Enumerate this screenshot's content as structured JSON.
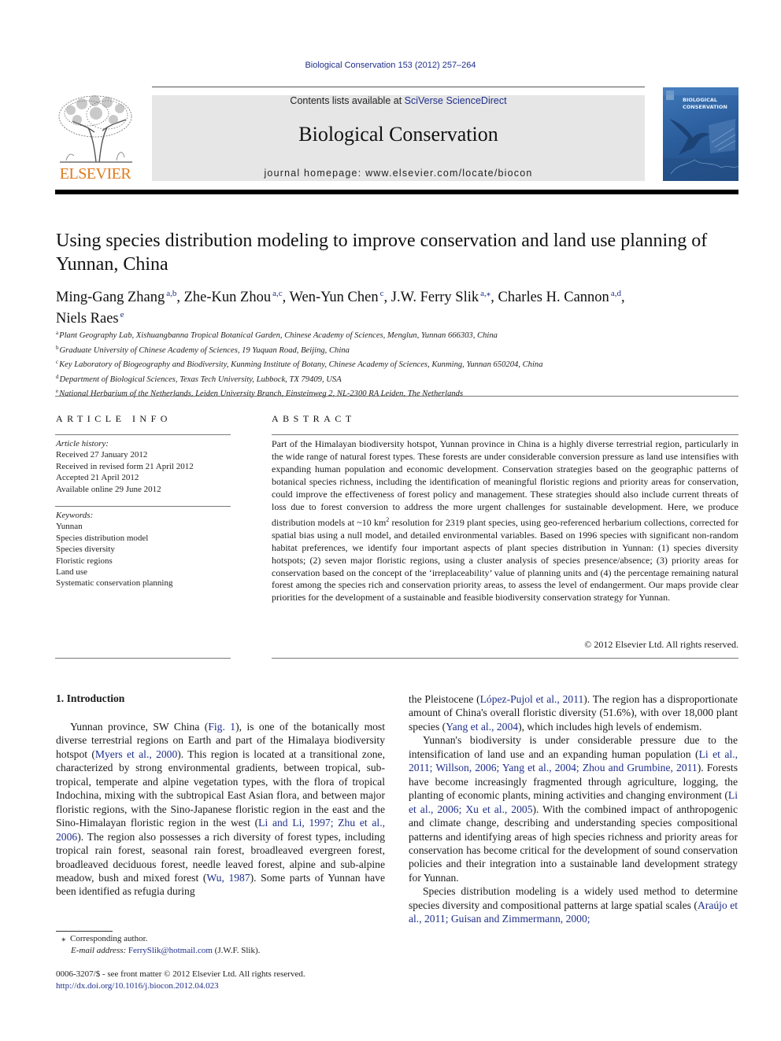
{
  "header": {
    "journal_ref": "Biological Conservation 153 (2012) 257–264",
    "contents_prefix": "Contents lists available at ",
    "contents_link": "SciVerse ScienceDirect",
    "journal_name": "Biological Conservation",
    "homepage_prefix": "journal homepage: ",
    "homepage_url": "www.elsevier.com/locate/biocon",
    "publisher_logo_text": "ELSEVIER",
    "cover_title_line1": "BIOLOGICAL",
    "cover_title_line2": "CONSERVATION",
    "colors": {
      "link": "#1f2f8a",
      "publisher_orange": "#e07a1a",
      "banner_gray": "#e6e6e6",
      "cover_blue": "#2c5f9e"
    }
  },
  "article": {
    "title": "Using species distribution modeling to improve conservation and land use planning of Yunnan, China",
    "authors": [
      {
        "name": "Ming-Gang Zhang",
        "sup": "a,b",
        "sep": ", "
      },
      {
        "name": "Zhe-Kun Zhou",
        "sup": "a,c",
        "sep": ", "
      },
      {
        "name": "Wen-Yun Chen",
        "sup": "c",
        "sep": ", "
      },
      {
        "name": "J.W. Ferry Slik",
        "sup": "a,⁎",
        "sep": ", "
      },
      {
        "name": "Charles H. Cannon",
        "sup": "a,d",
        "sep": ","
      },
      {
        "name": "Niels Raes",
        "sup": "e",
        "sep": ""
      }
    ],
    "affiliations": [
      {
        "key": "a",
        "text": "Plant Geography Lab, Xishuangbanna Tropical Botanical Garden, Chinese Academy of Sciences, Menglun, Yunnan 666303, China"
      },
      {
        "key": "b",
        "text": "Graduate University of Chinese Academy of Sciences, 19 Yuquan Road, Beijing, China"
      },
      {
        "key": "c",
        "text": "Key Laboratory of Biogeography and Biodiversity, Kunming Institute of Botany, Chinese Academy of Sciences, Kunming, Yunnan 650204, China"
      },
      {
        "key": "d",
        "text": "Department of Biological Sciences, Texas Tech University, Lubbock, TX 79409, USA"
      },
      {
        "key": "e",
        "text": "National Herbarium of the Netherlands, Leiden University Branch, Einsteinweg 2, NL-2300 RA Leiden, The Netherlands"
      }
    ]
  },
  "article_info": {
    "heading": "ARTICLE INFO",
    "history_label": "Article history:",
    "history": [
      "Received 27 January 2012",
      "Received in revised form 21 April 2012",
      "Accepted 21 April 2012",
      "Available online 29 June 2012"
    ],
    "keywords_label": "Keywords:",
    "keywords": [
      "Yunnan",
      "Species distribution model",
      "Species diversity",
      "Floristic regions",
      "Land use",
      "Systematic conservation planning"
    ]
  },
  "abstract": {
    "heading": "ABSTRACT",
    "text_before_sup": "Part of the Himalayan biodiversity hotspot, Yunnan province in China is a highly diverse terrestrial region, particularly in the wide range of natural forest types. These forests are under considerable conversion pressure as land use intensifies with expanding human population and economic development. Conservation strategies based on the geographic patterns of botanical species richness, including the identification of meaningful floristic regions and priority areas for conservation, could improve the effectiveness of forest policy and management. These strategies should also include current threats of loss due to forest conversion to address the more urgent challenges for sustainable development. Here, we produce distribution models at ~10 km",
    "sup": "2",
    "text_after_sup": " resolution for 2319 plant species, using geo-referenced herbarium collections, corrected for spatial bias using a null model, and detailed environmental variables. Based on 1996 species with significant non-random habitat preferences, we identify four important aspects of plant species distribution in Yunnan: (1) species diversity hotspots; (2) seven major floristic regions, using a cluster analysis of species presence/absence; (3) priority areas for conservation based on the concept of the ‘irreplaceability’ value of planning units and (4) the percentage remaining natural forest among the species rich and conservation priority areas, to assess the level of endangerment. Our maps provide clear priorities for the development of a sustainable and feasible biodiversity conservation strategy for Yunnan.",
    "copyright": "© 2012 Elsevier Ltd. All rights reserved."
  },
  "introduction": {
    "heading": "1. Introduction",
    "left": {
      "p1": [
        {
          "t": "Yunnan province, SW China ("
        },
        {
          "t": "Fig. 1",
          "link": true
        },
        {
          "t": "), is one of the botanically most diverse terrestrial regions on Earth and part of the Himalaya biodiversity hotspot ("
        },
        {
          "t": "Myers et al., 2000",
          "link": true
        },
        {
          "t": "). This region is located at a transitional zone, characterized by strong environmental gradients, between tropical, sub-tropical, temperate and alpine vegetation types, with the flora of tropical Indochina, mixing with the subtropical East Asian flora, and between major floristic regions, with the Sino-Japanese floristic region in the east and the Sino-Himalayan floristic region in the west ("
        },
        {
          "t": "Li and Li, 1997; Zhu et al., 2006",
          "link": true
        },
        {
          "t": "). The region also possesses a rich diversity of forest types, including tropical rain forest, seasonal rain forest, broadleaved evergreen forest, broadleaved deciduous forest, needle leaved forest, alpine and sub-alpine meadow, bush and mixed forest ("
        },
        {
          "t": "Wu, 1987",
          "link": true
        },
        {
          "t": "). Some parts of Yunnan have been identified as refugia during"
        }
      ]
    },
    "right": {
      "p1_cont": [
        {
          "t": "the Pleistocene ("
        },
        {
          "t": "López-Pujol et al., 2011",
          "link": true
        },
        {
          "t": "). The region has a disproportionate amount of China's overall floristic diversity (51.6%), with over 18,000 plant species ("
        },
        {
          "t": "Yang et al., 2004",
          "link": true
        },
        {
          "t": "), which includes high levels of endemism."
        }
      ],
      "p2": [
        {
          "t": "Yunnan's biodiversity is under considerable pressure due to the intensification of land use and an expanding human population ("
        },
        {
          "t": "Li et al., 2011; Willson, 2006; Yang et al., 2004; Zhou and Grumbine, 2011",
          "link": true
        },
        {
          "t": "). Forests have become increasingly fragmented through agriculture, logging, the planting of economic plants, mining activities and changing environment ("
        },
        {
          "t": "Li et al., 2006; Xu et al., 2005",
          "link": true
        },
        {
          "t": "). With the combined impact of anthropogenic and climate change, describing and understanding species compositional patterns and identifying areas of high species richness and priority areas for conservation has become critical for the development of sound conservation policies and their integration into a sustainable land development strategy for Yunnan."
        }
      ],
      "p3": [
        {
          "t": "Species distribution modeling is a widely used method to determine species diversity and compositional patterns at large spatial scales ("
        },
        {
          "t": "Araújo et al., 2011; Guisan and Zimmermann, 2000;",
          "link": true
        }
      ]
    }
  },
  "footnotes": {
    "star": "⁎",
    "corresponding": "Corresponding author.",
    "email_label": "E-mail address:",
    "email": "FerrySlik@hotmail.com",
    "email_suffix": " (J.W.F. Slik).",
    "issn_line": "0006-3207/$ - see front matter © 2012 Elsevier Ltd. All rights reserved.",
    "doi": "http://dx.doi.org/10.1016/j.biocon.2012.04.023"
  }
}
